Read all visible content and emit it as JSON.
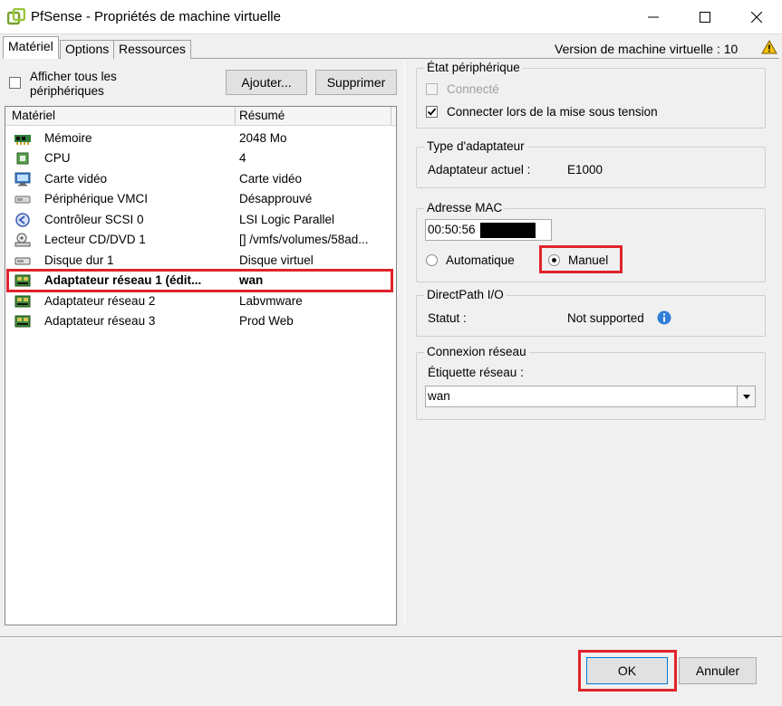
{
  "window": {
    "title": "PfSense - Propriétés de machine virtuelle",
    "icons": {
      "app": "vsphere-logo-icon",
      "minimize": "minimize-icon",
      "maximize": "maximize-icon",
      "close": "close-icon"
    }
  },
  "tabs": [
    {
      "label": "Matériel",
      "active": true
    },
    {
      "label": "Options",
      "active": false
    },
    {
      "label": "Ressources",
      "active": false
    }
  ],
  "version_text": "Version de machine virtuelle : 10",
  "left": {
    "show_all_label": "Afficher tous les périphériques",
    "show_all_line1": "Afficher tous les",
    "show_all_line2": "périphériques",
    "show_all_checked": false,
    "add_button": "Ajouter...",
    "remove_button": "Supprimer",
    "columns": {
      "hardware": "Matériel",
      "summary": "Résumé"
    },
    "rows": [
      {
        "name": "Mémoire",
        "summary": "2048 Mo",
        "icon": "memory-icon"
      },
      {
        "name": "CPU",
        "summary": "4",
        "icon": "cpu-icon"
      },
      {
        "name": "Carte vidéo",
        "summary": "Carte vidéo",
        "icon": "monitor-icon"
      },
      {
        "name": "Périphérique VMCI",
        "summary": "Désapprouvé",
        "icon": "vmci-device-icon"
      },
      {
        "name": "Contrôleur SCSI 0",
        "summary": "LSI Logic Parallel",
        "icon": "scsi-controller-icon"
      },
      {
        "name": "Lecteur CD/DVD 1",
        "summary": "[] /vmfs/volumes/58ad...",
        "icon": "cd-dvd-drive-icon"
      },
      {
        "name": "Disque dur 1",
        "summary": "Disque virtuel",
        "icon": "hard-disk-icon"
      },
      {
        "name": "Adaptateur réseau 1 (édit...",
        "summary": "wan",
        "icon": "network-adapter-icon",
        "selected": true
      },
      {
        "name": "Adaptateur réseau 2",
        "summary": "Labvmware",
        "icon": "network-adapter-icon"
      },
      {
        "name": "Adaptateur réseau 3",
        "summary": "Prod Web",
        "icon": "network-adapter-icon"
      }
    ]
  },
  "device_status": {
    "title": "État périphérique",
    "connected_label": "Connecté",
    "connected_checked": false,
    "connect_at_power_on_label": "Connecter lors de la mise sous tension",
    "connect_at_power_on_checked": true
  },
  "adapter_type": {
    "title": "Type d'adaptateur",
    "current_label": "Adaptateur actuel :",
    "current_value": "E1000"
  },
  "mac": {
    "title": "Adresse MAC",
    "value": "00:50:56",
    "auto_label": "Automatique",
    "manual_label": "Manuel",
    "selected": "manual"
  },
  "directpath": {
    "title": "DirectPath I/O",
    "status_label": "Statut :",
    "status_value": "Not supported",
    "info_icon": "info-icon"
  },
  "network_connection": {
    "title": "Connexion réseau",
    "label": "Étiquette réseau :",
    "value": "wan"
  },
  "footer": {
    "ok": "OK",
    "cancel": "Annuler"
  },
  "colors": {
    "highlight": "#e0232b",
    "info_blue": "#2f7ed8",
    "warning_yellow": "#f4c20d"
  }
}
